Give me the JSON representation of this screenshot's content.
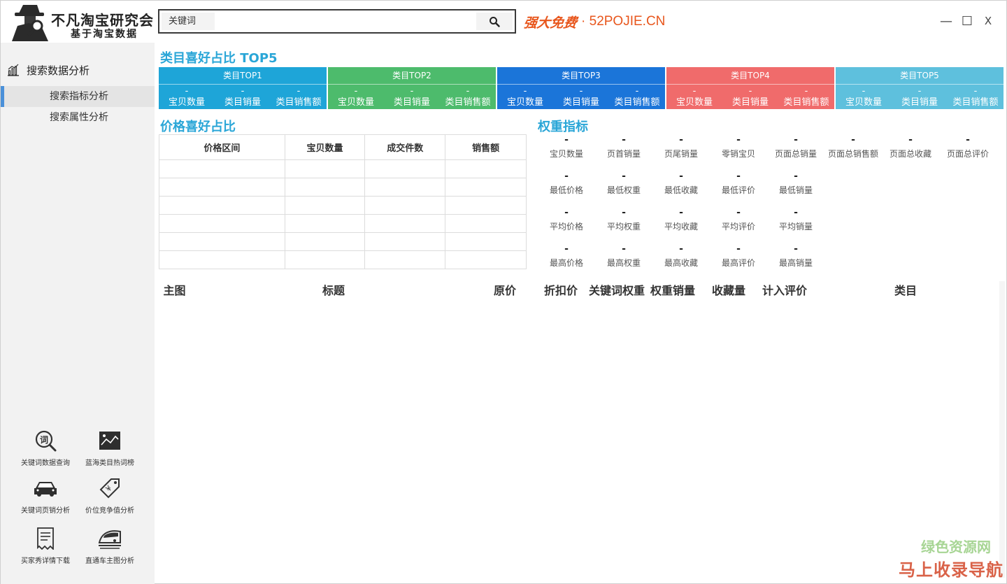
{
  "header": {
    "logo_title": "不凡淘宝研究会",
    "logo_subtitle": "基于淘宝数据",
    "search_tag": "关键词",
    "search_value": "",
    "promo_text": "强大免费",
    "promo_site": "· 52POJIE.CN",
    "window_controls": {
      "minimize": "—",
      "maximize": "☐",
      "close": "X"
    }
  },
  "sidebar": {
    "section_label": "搜索数据分析",
    "items": [
      {
        "label": "搜索指标分析",
        "active": true
      },
      {
        "label": "搜索属性分析",
        "active": false
      }
    ],
    "tools": [
      {
        "label": "关键词数据查询",
        "icon": "keyword-search-icon"
      },
      {
        "label": "蓝海类目热词榜",
        "icon": "image-chart-icon"
      },
      {
        "label": "关键词页销分析",
        "icon": "car-icon"
      },
      {
        "label": "价位竞争值分析",
        "icon": "price-tag-icon"
      },
      {
        "label": "买家秀详情下载",
        "icon": "document-icon"
      },
      {
        "label": "直通车主图分析",
        "icon": "train-icon"
      }
    ]
  },
  "category_section": {
    "title": "类目喜好占比 TOP5",
    "cards": [
      {
        "title": "类目TOP1",
        "color": "#1ea5d8",
        "values": [
          "-",
          "-",
          "-"
        ],
        "labels": [
          "宝贝数量",
          "类目销量",
          "类目销售额"
        ]
      },
      {
        "title": "类目TOP2",
        "color": "#4dbb6c",
        "values": [
          "-",
          "-",
          "-"
        ],
        "labels": [
          "宝贝数量",
          "类目销量",
          "类目销售额"
        ]
      },
      {
        "title": "类目TOP3",
        "color": "#1b75d9",
        "values": [
          "-",
          "-",
          "-"
        ],
        "labels": [
          "宝贝数量",
          "类目销量",
          "类目销售额"
        ]
      },
      {
        "title": "类目TOP4",
        "color": "#f06b6b",
        "values": [
          "-",
          "-",
          "-"
        ],
        "labels": [
          "宝贝数量",
          "类目销量",
          "类目销售额"
        ]
      },
      {
        "title": "类目TOP5",
        "color": "#5ec0dd",
        "values": [
          "-",
          "-",
          "-"
        ],
        "labels": [
          "宝贝数量",
          "类目销量",
          "类目销售额"
        ]
      }
    ]
  },
  "price_section": {
    "title": "价格喜好占比",
    "columns": [
      "价格区间",
      "宝贝数量",
      "成交件数",
      "销售额"
    ]
  },
  "weight_section": {
    "title": "权重指标",
    "rows": [
      [
        {
          "value": "-",
          "label": "宝贝数量"
        },
        {
          "value": "-",
          "label": "页首销量"
        },
        {
          "value": "-",
          "label": "页尾销量"
        },
        {
          "value": "-",
          "label": "零销宝贝"
        },
        {
          "value": "-",
          "label": "页面总销量"
        },
        {
          "value": "-",
          "label": "页面总销售额"
        },
        {
          "value": "-",
          "label": "页面总收藏"
        },
        {
          "value": "-",
          "label": "页面总评价"
        }
      ],
      [
        {
          "value": "-",
          "label": "最低价格"
        },
        {
          "value": "-",
          "label": "最低权重"
        },
        {
          "value": "-",
          "label": "最低收藏"
        },
        {
          "value": "-",
          "label": "最低评价"
        },
        {
          "value": "-",
          "label": "最低销量"
        }
      ],
      [
        {
          "value": "-",
          "label": "平均价格"
        },
        {
          "value": "-",
          "label": "平均权重"
        },
        {
          "value": "-",
          "label": "平均收藏"
        },
        {
          "value": "-",
          "label": "平均评价"
        },
        {
          "value": "-",
          "label": "平均销量"
        }
      ],
      [
        {
          "value": "-",
          "label": "最高价格"
        },
        {
          "value": "-",
          "label": "最高权重"
        },
        {
          "value": "-",
          "label": "最高收藏"
        },
        {
          "value": "-",
          "label": "最高评价"
        },
        {
          "value": "-",
          "label": "最高销量"
        }
      ]
    ]
  },
  "results_table": {
    "columns": [
      "主图",
      "标题",
      "原价",
      "折扣价",
      "关键词权重",
      "权重销量",
      "收藏量",
      "计入评价",
      "类目"
    ]
  },
  "watermark": {
    "line1": "绿色资源网",
    "line2": "马上收录导航"
  }
}
